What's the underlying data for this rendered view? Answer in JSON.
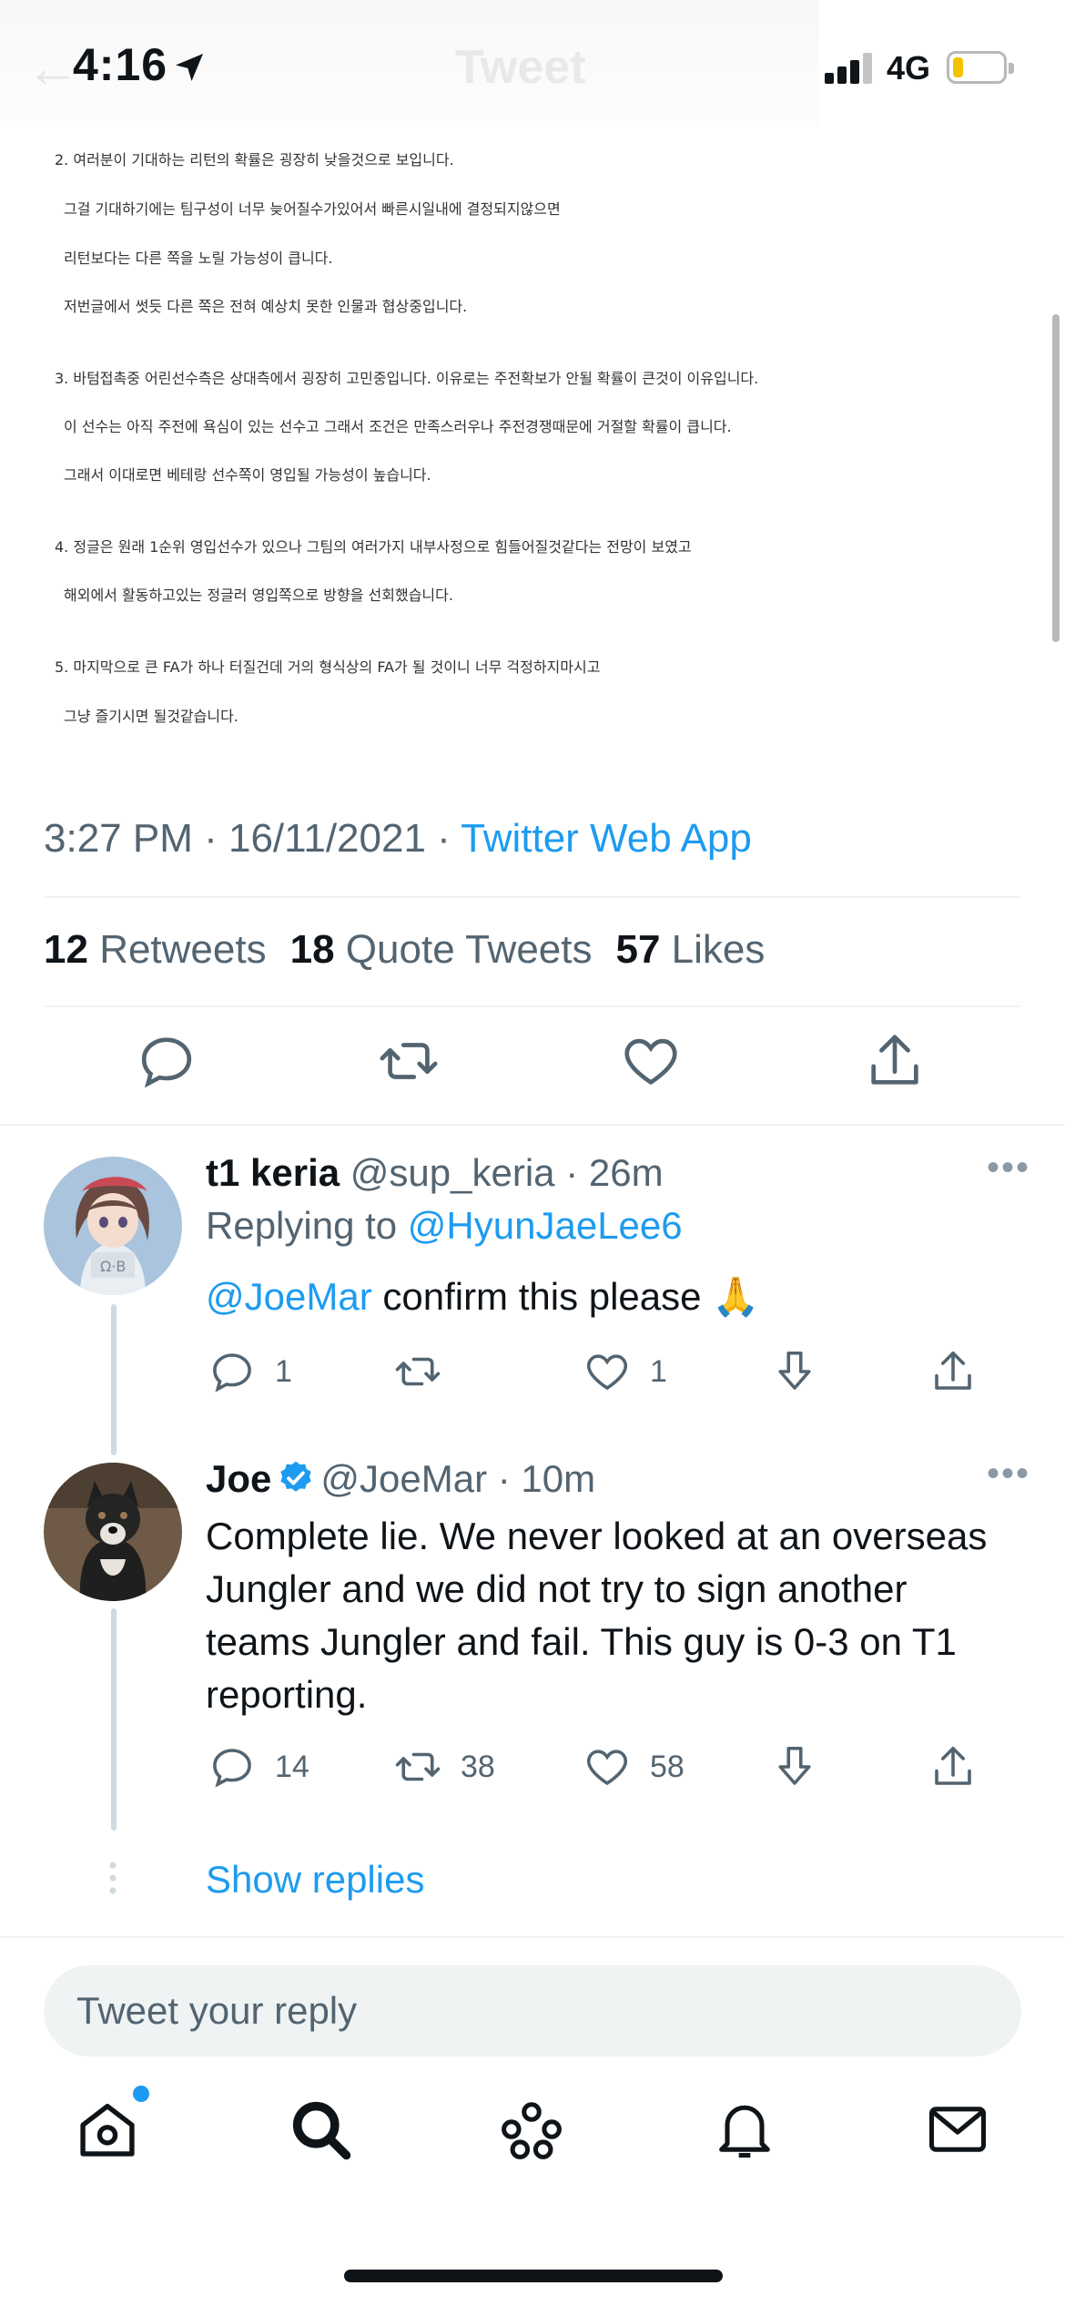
{
  "status_bar": {
    "time": "4:16",
    "network": "4G",
    "battery_level": 0.2
  },
  "header": {
    "title": "Tweet"
  },
  "tweet_image_text": [
    "2. 여러분이 기대하는 리턴의 확률은 굉장히 낮을것으로 보입니다.",
    "그걸 기대하기에는 팀구성이 너무 늦어질수가있어서 빠른시일내에 결정되지않으면",
    "리턴보다는 다른 쪽을 노릴 가능성이 큽니다.",
    "저번글에서 썻듯 다른 쪽은 전혀 예상치 못한 인물과 협상중입니다.",
    "3. 바텀접촉중 어린선수측은 상대측에서 굉장히 고민중입니다. 이유로는 주전확보가 안될 확률이 큰것이 이유입니다.",
    "이 선수는 아직 주전에 욕심이 있는 선수고 그래서 조건은 만족스러우나 주전경쟁때문에 거절할 확률이 큽니다.",
    "그래서 이대로면 베테랑 선수쪽이 영입될 가능성이 높습니다.",
    "4. 정글은 원래 1순위 영입선수가 있으나 그팀의 여러가지 내부사정으로 힘들어질것같다는 전망이 보였고",
    "해외에서 활동하고있는 정글러 영입쪽으로 방향을 선회했습니다.",
    "5. 마지막으로 큰 FA가 하나 터질건데 거의 형식상의 FA가 될 것이니 너무 걱정하지마시고",
    "그냥 즐기시면 될것같습니다."
  ],
  "tweet_meta": {
    "time": "3:27 PM",
    "date": "16/11/2021",
    "source": "Twitter Web App"
  },
  "stats": {
    "retweets_count": "12",
    "retweets_label": "Retweets",
    "quotes_count": "18",
    "quotes_label": "Quote Tweets",
    "likes_count": "57",
    "likes_label": "Likes"
  },
  "replies": [
    {
      "name": "t1 keria",
      "handle": "@sup_keria",
      "time": "26m",
      "replying_prefix": "Replying to",
      "replying_to": "@HyunJaeLee6",
      "mention": "@JoeMar",
      "text": " confirm this please 🙏",
      "reply_count": "1",
      "retweet_count": "",
      "like_count": "1"
    },
    {
      "name": "Joe",
      "handle": "@JoeMar",
      "time": "10m",
      "text": "Complete lie. We never looked at an overseas Jungler  and we did not try to sign another teams Jungler and fail. This guy is 0-3 on T1 reporting.",
      "reply_count": "14",
      "retweet_count": "38",
      "like_count": "58"
    }
  ],
  "show_replies_label": "Show replies",
  "reply_placeholder": "Tweet your reply",
  "colors": {
    "accent": "#1d9bf0",
    "secondary_text": "#536471",
    "divider": "#eff3f4"
  }
}
